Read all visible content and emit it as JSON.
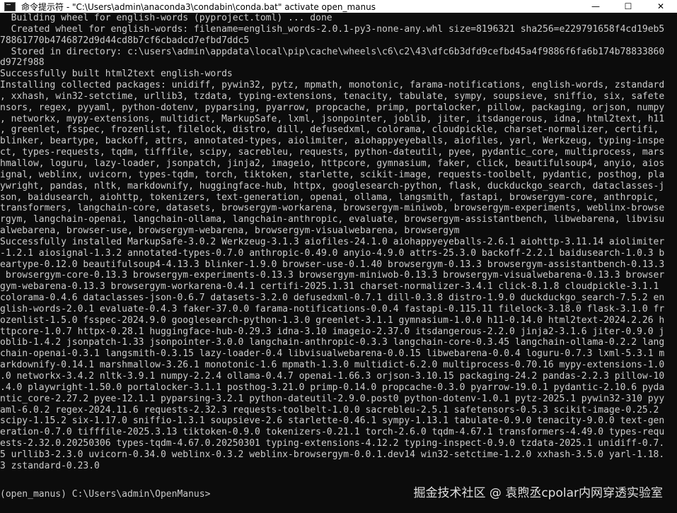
{
  "window": {
    "title": "命令提示符 - \"C:\\Users\\admin\\anaconda3\\condabin\\conda.bat\"  activate open_manus",
    "minimize_symbol": "—",
    "maximize_symbol": "☐",
    "close_symbol": "✕",
    "icon": "terminal-icon"
  },
  "console": {
    "lines": [
      "  Building wheel for english-words (pyproject.toml) ... done",
      "  Created wheel for english-words: filename=english_words-2.0.1-py3-none-any.whl size=8196321 sha256=e229791658f4cd19eb5",
      "78861770b4746872d9d44cd8b7cf6cbadcd7efbd7ddc5",
      "  Stored in directory: c:\\users\\admin\\appdata\\local\\pip\\cache\\wheels\\c6\\c2\\43\\dfc6b3dfd9cefbd45a4f9886f6fa6b174b78833860",
      "d972f988",
      "Successfully built html2text english-words",
      "Installing collected packages: unidiff, pywin32, pytz, mpmath, monotonic, farama-notifications, english-words, zstandard",
      ", xxhash, win32-setctime, urllib3, tzdata, typing-extensions, tenacity, tabulate, sympy, soupsieve, sniffio, six, safete",
      "nsors, regex, pyyaml, python-dotenv, pyparsing, pyarrow, propcache, primp, portalocker, pillow, packaging, orjson, numpy",
      ", networkx, mypy-extensions, multidict, MarkupSafe, lxml, jsonpointer, joblib, jiter, itsdangerous, idna, html2text, h11",
      ", greenlet, fsspec, frozenlist, filelock, distro, dill, defusedxml, colorama, cloudpickle, charset-normalizer, certifi,",
      "blinker, beartype, backoff, attrs, annotated-types, aiolimiter, aiohappyeyeballs, aiofiles, yarl, Werkzeug, typing-inspe",
      "ct, types-requests, tqdm, tifffile, scipy, sacrebleu, requests, python-dateutil, pyee, pydantic_core, multiprocess, mars",
      "hmallow, loguru, lazy-loader, jsonpatch, jinja2, imageio, httpcore, gymnasium, faker, click, beautifulsoup4, anyio, aios",
      "ignal, weblinx, uvicorn, types-tqdm, torch, tiktoken, starlette, scikit-image, requests-toolbelt, pydantic, posthog, pla",
      "ywright, pandas, nltk, markdownify, huggingface-hub, httpx, googlesearch-python, flask, duckduckgo_search, dataclasses-j",
      "son, baidusearch, aiohttp, tokenizers, text-generation, openai, ollama, langsmith, fastapi, browsergym-core, anthropic,",
      "transformers, langchain-core, datasets, browsergym-workarena, browsergym-miniwob, browsergym-experiments, weblinx-browse",
      "rgym, langchain-openai, langchain-ollama, langchain-anthropic, evaluate, browsergym-assistantbench, libwebarena, libvisu",
      "alwebarena, browser-use, browsergym-webarena, browsergym-visualwebarena, browsergym",
      "Successfully installed MarkupSafe-3.0.2 Werkzeug-3.1.3 aiofiles-24.1.0 aiohappyeyeballs-2.6.1 aiohttp-3.11.14 aiolimiter",
      "-1.2.1 aiosignal-1.3.2 annotated-types-0.7.0 anthropic-0.49.0 anyio-4.9.0 attrs-25.3.0 backoff-2.2.1 baidusearch-1.0.3 b",
      "eartype-0.12.0 beautifulsoup4-4.13.3 blinker-1.9.0 browser-use-0.1.40 browsergym-0.13.3 browsergym-assistantbench-0.13.3",
      " browsergym-core-0.13.3 browsergym-experiments-0.13.3 browsergym-miniwob-0.13.3 browsergym-visualwebarena-0.13.3 browser",
      "gym-webarena-0.13.3 browsergym-workarena-0.4.1 certifi-2025.1.31 charset-normalizer-3.4.1 click-8.1.8 cloudpickle-3.1.1",
      "colorama-0.4.6 dataclasses-json-0.6.7 datasets-3.2.0 defusedxml-0.7.1 dill-0.3.8 distro-1.9.0 duckduckgo_search-7.5.2 en",
      "glish-words-2.0.1 evaluate-0.4.3 faker-37.0.0 farama-notifications-0.0.4 fastapi-0.115.11 filelock-3.18.0 flask-3.1.0 fr",
      "ozenlist-1.5.0 fsspec-2024.9.0 googlesearch-python-1.3.0 greenlet-3.1.1 gymnasium-1.0.0 h11-0.14.0 html2text-2024.2.26 h",
      "ttpcore-1.0.7 httpx-0.28.1 huggingface-hub-0.29.3 idna-3.10 imageio-2.37.0 itsdangerous-2.2.0 jinja2-3.1.6 jiter-0.9.0 j",
      "oblib-1.4.2 jsonpatch-1.33 jsonpointer-3.0.0 langchain-anthropic-0.3.3 langchain-core-0.3.45 langchain-ollama-0.2.2 lang",
      "chain-openai-0.3.1 langsmith-0.3.15 lazy-loader-0.4 libvisualwebarena-0.0.15 libwebarena-0.0.4 loguru-0.7.3 lxml-5.3.1 m",
      "arkdownify-0.14.1 marshmallow-3.26.1 monotonic-1.6 mpmath-1.3.0 multidict-6.2.0 multiprocess-0.70.16 mypy-extensions-1.0",
      ".0 networkx-3.4.2 nltk-3.9.1 numpy-2.2.4 ollama-0.4.7 openai-1.66.3 orjson-3.10.15 packaging-24.2 pandas-2.2.3 pillow-10",
      ".4.0 playwright-1.50.0 portalocker-3.1.1 posthog-3.21.0 primp-0.14.0 propcache-0.3.0 pyarrow-19.0.1 pydantic-2.10.6 pyda",
      "ntic_core-2.27.2 pyee-12.1.1 pyparsing-3.2.1 python-dateutil-2.9.0.post0 python-dotenv-1.0.1 pytz-2025.1 pywin32-310 pyy",
      "aml-6.0.2 regex-2024.11.6 requests-2.32.3 requests-toolbelt-1.0.0 sacrebleu-2.5.1 safetensors-0.5.3 scikit-image-0.25.2",
      "scipy-1.15.2 six-1.17.0 sniffio-1.3.1 soupsieve-2.6 starlette-0.46.1 sympy-1.13.1 tabulate-0.9.0 tenacity-9.0.0 text-gen",
      "eration-0.7.0 tifffile-2025.3.13 tiktoken-0.9.0 tokenizers-0.21.1 torch-2.6.0 tqdm-4.67.1 transformers-4.49.0 types-requ",
      "ests-2.32.0.20250306 types-tqdm-4.67.0.20250301 typing-extensions-4.12.2 typing-inspect-0.9.0 tzdata-2025.1 unidiff-0.7.",
      "5 urllib3-2.3.0 uvicorn-0.34.0 weblinx-0.3.2 weblinx-browsergym-0.0.1.dev14 win32-setctime-1.2.0 xxhash-3.5.0 yarl-1.18.",
      "3 zstandard-0.23.0",
      ""
    ],
    "prompt": "(open_manus) C:\\Users\\admin\\OpenManus>"
  },
  "watermark": "掘金技术社区 @ 袁煦丞cpolar内网穿透实验室"
}
